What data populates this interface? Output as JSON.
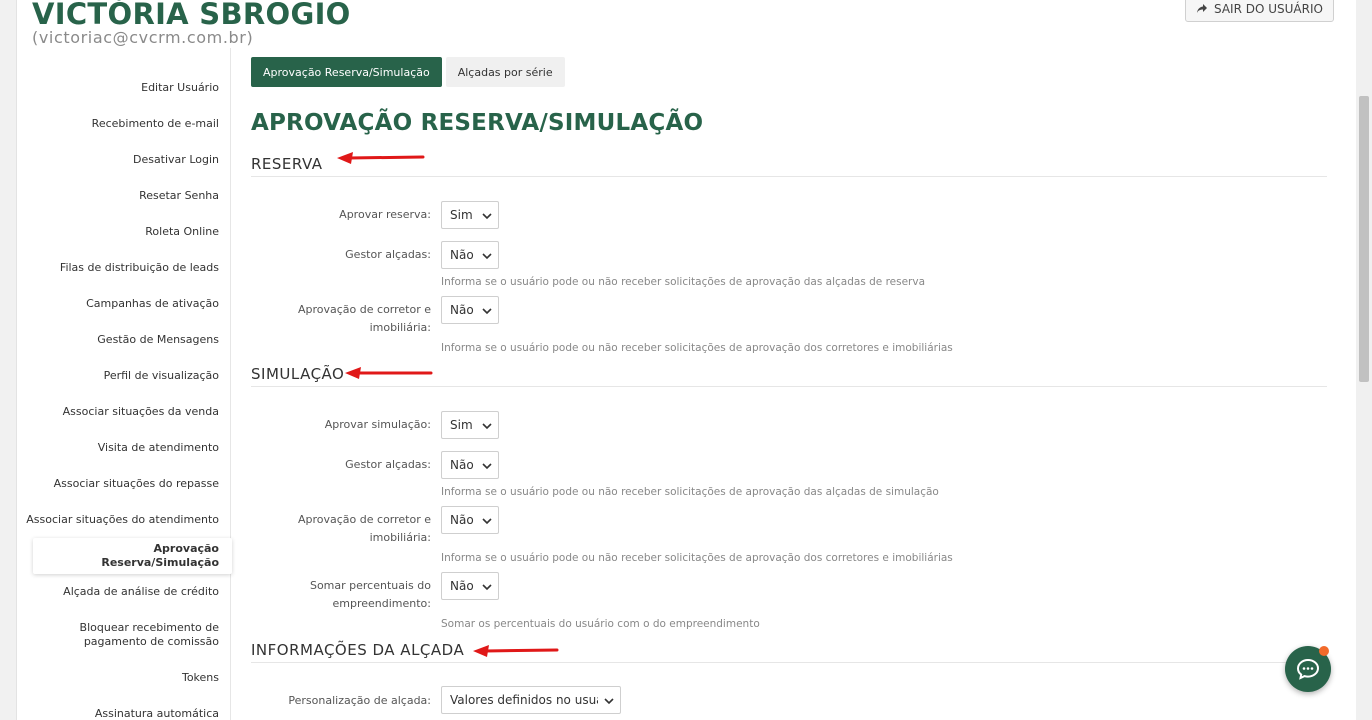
{
  "header": {
    "name": "VICTÓRIA SBROGIO",
    "email": "(victoriac@cvcrm.com.br)",
    "exit_label": "SAIR DO USUÁRIO"
  },
  "sidebar": {
    "items": [
      "Editar Usuário",
      "Recebimento de e-mail",
      "Desativar Login",
      "Resetar Senha",
      "Roleta Online",
      "Filas de distribuição de leads",
      "Campanhas de ativação",
      "Gestão de Mensagens",
      "Perfil de visualização",
      "Associar situações da venda",
      "Visita de atendimento",
      "Associar situações do repasse",
      "Associar situações do atendimento",
      "Aprovação Reserva/Simulação",
      "Alçada de análise de crédito",
      "Bloquear recebimento de pagamento de comissão",
      "Tokens",
      "Assinatura automática"
    ],
    "active": "Aprovação Reserva/Simulação"
  },
  "tabs": [
    {
      "label": "Aprovação Reserva/Simulação",
      "active": true
    },
    {
      "label": "Alçadas por série",
      "active": false
    }
  ],
  "main": {
    "title": "APROVAÇÃO RESERVA/SIMULAÇÃO",
    "reserva": {
      "title": "RESERVA",
      "aprovar_label": "Aprovar reserva:",
      "aprovar_value": "Sim",
      "gestor_label": "Gestor alçadas:",
      "gestor_value": "Não",
      "gestor_help": "Informa se o usuário pode ou não receber solicitações de aprovação das alçadas de reserva",
      "corretor_label": "Aprovação de corretor e imobiliária:",
      "corretor_value": "Não",
      "corretor_help": "Informa se o usuário pode ou não receber solicitações de aprovação dos corretores e imobiliárias"
    },
    "simulacao": {
      "title": "SIMULAÇÃO",
      "aprovar_label": "Aprovar simulação:",
      "aprovar_value": "Sim",
      "gestor_label": "Gestor alçadas:",
      "gestor_value": "Não",
      "gestor_help": "Informa se o usuário pode ou não receber solicitações de aprovação das alçadas de simulação",
      "corretor_label": "Aprovação de corretor e imobiliária:",
      "corretor_value": "Não",
      "corretor_help": "Informa se o usuário pode ou não receber solicitações de aprovação dos corretores e imobiliárias",
      "somar_label": "Somar percentuais do empreendimento:",
      "somar_value": "Não",
      "somar_help": "Somar os percentuais do usuário com o do empreendimento"
    },
    "informacoes": {
      "title": "INFORMAÇÕES DA ALÇADA",
      "personalizacao_label": "Personalização de alçada:",
      "personalizacao_value": "Valores definidos no usuário"
    }
  },
  "colors": {
    "brand": "#28634a",
    "arrow": "#e01818",
    "notification": "#f26a2b"
  }
}
